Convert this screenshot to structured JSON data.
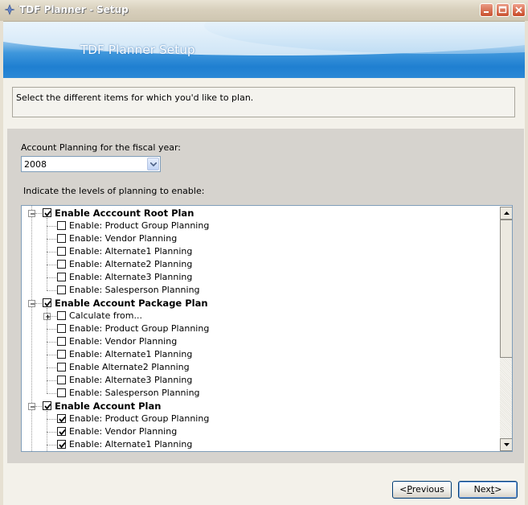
{
  "window": {
    "title": "TDF Planner - Setup"
  },
  "banner": {
    "title": "TDF Planner Setup"
  },
  "instruction": "Select the different items for which you'd like to plan.",
  "fiscal": {
    "label": "Account Planning for the fiscal year:",
    "selected": "2008"
  },
  "levels_label": "Indicate the levels of planning to enable:",
  "tree": [
    {
      "label": "Enable Acccount Root Plan",
      "level": 0,
      "checked": true,
      "expander": "minus"
    },
    {
      "label": "Enable: Product Group Planning",
      "level": 1,
      "checked": false
    },
    {
      "label": "Enable: Vendor Planning",
      "level": 1,
      "checked": false
    },
    {
      "label": "Enable: Alternate1 Planning",
      "level": 1,
      "checked": false
    },
    {
      "label": "Enable: Alternate2 Planning",
      "level": 1,
      "checked": false
    },
    {
      "label": "Enable: Alternate3 Planning",
      "level": 1,
      "checked": false
    },
    {
      "label": "Enable: Salesperson Planning",
      "level": 1,
      "checked": false
    },
    {
      "label": "Enable Account Package Plan",
      "level": 0,
      "checked": true,
      "expander": "minus"
    },
    {
      "label": "Calculate from...",
      "level": 1,
      "checked": false,
      "expander": "plus"
    },
    {
      "label": "Enable: Product Group Planning",
      "level": 1,
      "checked": false
    },
    {
      "label": "Enable: Vendor Planning",
      "level": 1,
      "checked": false
    },
    {
      "label": "Enable: Alternate1 Planning",
      "level": 1,
      "checked": false
    },
    {
      "label": "Enable Alternate2 Planning",
      "level": 1,
      "checked": false
    },
    {
      "label": "Enable: Alternate3 Planning",
      "level": 1,
      "checked": false
    },
    {
      "label": "Enable: Salesperson Planning",
      "level": 1,
      "checked": false
    },
    {
      "label": "Enable Account Plan",
      "level": 0,
      "checked": true,
      "expander": "minus"
    },
    {
      "label": "Enable: Product Group Planning",
      "level": 1,
      "checked": true
    },
    {
      "label": "Enable: Vendor Planning",
      "level": 1,
      "checked": true
    },
    {
      "label": "Enable: Alternate1 Planning",
      "level": 1,
      "checked": true
    }
  ],
  "buttons": {
    "previous": "Previous",
    "next": "Next"
  },
  "icons": {
    "app": "app-icon",
    "minimize": "minimize-icon",
    "maximize": "maximize-icon",
    "close": "close-icon"
  }
}
